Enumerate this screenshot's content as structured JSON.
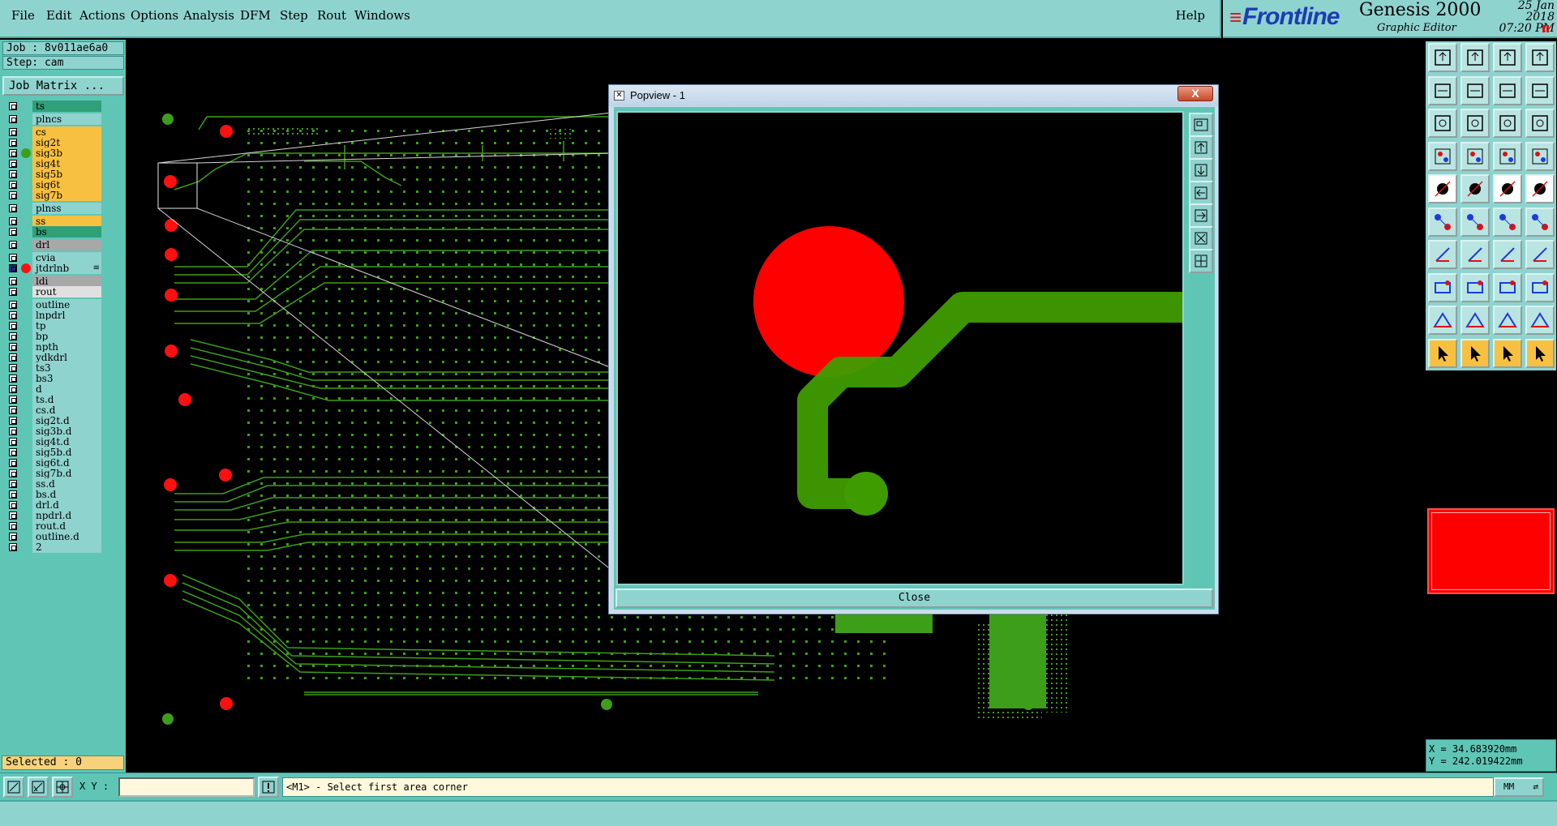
{
  "menu": {
    "items": [
      "File",
      "Edit",
      "Actions",
      "Options",
      "Analysis",
      "DFM",
      "Step",
      "Rout",
      "Windows"
    ],
    "help": "Help"
  },
  "brand": {
    "logo": "Frontline",
    "product": "Genesis 2000",
    "subtitle": "Graphic Editor",
    "date": "25 Jan 2018",
    "time": "07:20 PM"
  },
  "job": {
    "job_label": "Job : 8v011ae6a0",
    "step_label": "Step: cam",
    "matrix_button": "Job Matrix ..."
  },
  "layers": [
    {
      "name": "ts",
      "color": "#2fa07a",
      "group": 0
    },
    {
      "name": "plncs",
      "color": "#8fd3cf",
      "group": 1
    },
    {
      "name": "cs",
      "color": "#f8c040",
      "group": 2
    },
    {
      "name": "sig2t",
      "color": "#f8c040",
      "group": 2
    },
    {
      "name": "sig3b",
      "color": "#f8c040",
      "group": 2,
      "dot": "#3d9e1a"
    },
    {
      "name": "sig4t",
      "color": "#f8c040",
      "group": 2
    },
    {
      "name": "sig5b",
      "color": "#f8c040",
      "group": 2
    },
    {
      "name": "sig6t",
      "color": "#f8c040",
      "group": 2
    },
    {
      "name": "sig7b",
      "color": "#f8c040",
      "group": 2
    },
    {
      "name": "plnss",
      "color": "#8fd3cf",
      "group": 3
    },
    {
      "name": "ss",
      "color": "#f8c040",
      "group": 4
    },
    {
      "name": "bs",
      "color": "#2fa07a",
      "group": 4
    },
    {
      "name": "drl",
      "color": "#a8a8a8",
      "group": 5
    },
    {
      "name": "cvia",
      "color": "#8fd3cf",
      "group": 6
    },
    {
      "name": "jtdrlnb",
      "color": "#8fd3cf",
      "group": 6,
      "dot": "#ff1010",
      "active": true
    },
    {
      "name": "ldi",
      "color": "#a8a8a8",
      "group": 7
    },
    {
      "name": "rout",
      "color": "#e0e0e0",
      "group": 7
    },
    {
      "name": "outline",
      "color": "#8fd3cf",
      "group": 8
    },
    {
      "name": "lnpdrl",
      "color": "#8fd3cf",
      "group": 8
    },
    {
      "name": "tp",
      "color": "#8fd3cf",
      "group": 8
    },
    {
      "name": "bp",
      "color": "#8fd3cf",
      "group": 8
    },
    {
      "name": "npth",
      "color": "#8fd3cf",
      "group": 8
    },
    {
      "name": "ydkdrl",
      "color": "#8fd3cf",
      "group": 8
    },
    {
      "name": "ts3",
      "color": "#8fd3cf",
      "group": 8
    },
    {
      "name": "bs3",
      "color": "#8fd3cf",
      "group": 8
    },
    {
      "name": "d",
      "color": "#8fd3cf",
      "group": 8
    },
    {
      "name": "ts.d",
      "color": "#8fd3cf",
      "group": 8
    },
    {
      "name": "cs.d",
      "color": "#8fd3cf",
      "group": 8
    },
    {
      "name": "sig2t.d",
      "color": "#8fd3cf",
      "group": 8
    },
    {
      "name": "sig3b.d",
      "color": "#8fd3cf",
      "group": 8
    },
    {
      "name": "sig4t.d",
      "color": "#8fd3cf",
      "group": 8
    },
    {
      "name": "sig5b.d",
      "color": "#8fd3cf",
      "group": 8
    },
    {
      "name": "sig6t.d",
      "color": "#8fd3cf",
      "group": 8
    },
    {
      "name": "sig7b.d",
      "color": "#8fd3cf",
      "group": 8
    },
    {
      "name": "ss.d",
      "color": "#8fd3cf",
      "group": 8
    },
    {
      "name": "bs.d",
      "color": "#8fd3cf",
      "group": 8
    },
    {
      "name": "drl.d",
      "color": "#8fd3cf",
      "group": 8
    },
    {
      "name": "npdrl.d",
      "color": "#8fd3cf",
      "group": 8
    },
    {
      "name": "rout.d",
      "color": "#8fd3cf",
      "group": 8
    },
    {
      "name": "outline.d",
      "color": "#8fd3cf",
      "group": 8
    },
    {
      "name": "2",
      "color": "#8fd3cf",
      "group": 8
    }
  ],
  "selected_label": "Selected : 0",
  "coords": {
    "x": "X = 34.683920mm",
    "y": "Y = 242.019422mm"
  },
  "bottom": {
    "xy_label": "X Y :",
    "xy_value": "",
    "status": "<M1> - Select first area corner",
    "units": "MM"
  },
  "popview": {
    "title": "Popview - 1",
    "close_x": "X",
    "close_button": "Close"
  },
  "colors": {
    "panel": "#5fc6b6",
    "panel_light": "#8fd3cf",
    "trace": "#3d9e1a",
    "pad": "#ff0000",
    "highlight": "#f8c040"
  }
}
